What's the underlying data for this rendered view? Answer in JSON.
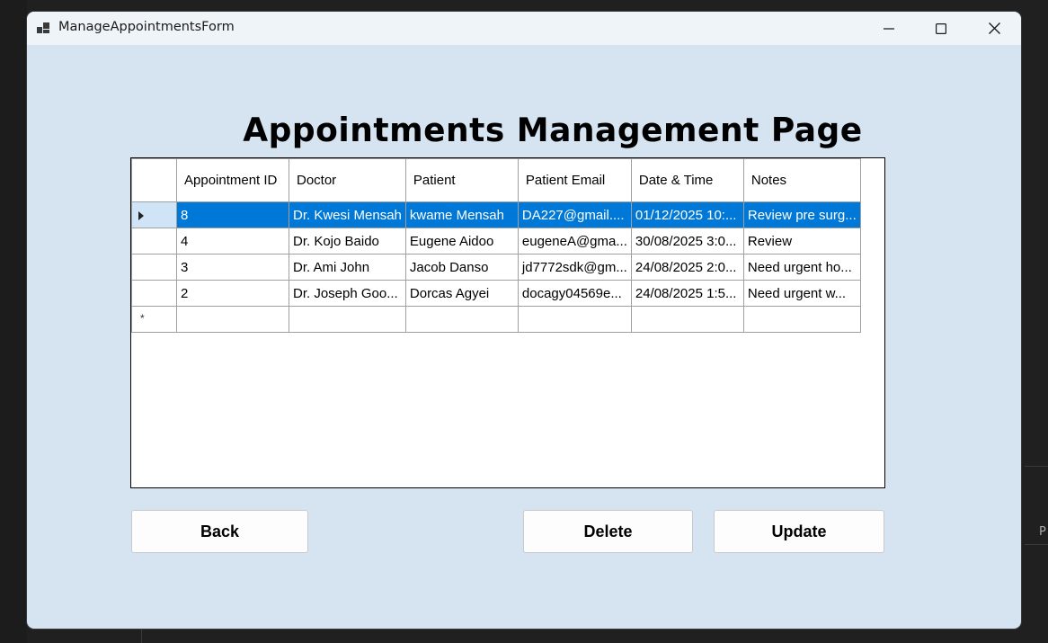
{
  "window": {
    "title": "ManageAppointmentsForm"
  },
  "heading": "Appointments Management Page",
  "grid": {
    "columns": [
      "Appointment ID",
      "Doctor",
      "Patient",
      "Patient Email",
      "Date & Time",
      "Notes"
    ],
    "rows": [
      [
        "8",
        "Dr. Kwesi Mensah",
        "kwame Mensah",
        "DA227@gmail....",
        "01/12/2025 10:...",
        "Review pre surg..."
      ],
      [
        "4",
        "Dr. Kojo Baido",
        "Eugene Aidoo",
        "eugeneA@gma...",
        "30/08/2025 3:0...",
        "Review"
      ],
      [
        "3",
        "Dr. Ami John",
        "Jacob Danso",
        "jd7772sdk@gm...",
        "24/08/2025 2:0...",
        "Need urgent ho..."
      ],
      [
        "2",
        "Dr. Joseph Goo...",
        "Dorcas Agyei",
        "docagy04569e...",
        "24/08/2025 1:5...",
        "Need urgent w..."
      ]
    ],
    "selected_row": 0,
    "new_row_marker": "*"
  },
  "buttons": {
    "back": "Back",
    "delete": "Delete",
    "update": "Update"
  },
  "background": {
    "side_letter": "P"
  },
  "colors": {
    "window_bg": "#d6e4f1",
    "selection": "#0078d7"
  }
}
